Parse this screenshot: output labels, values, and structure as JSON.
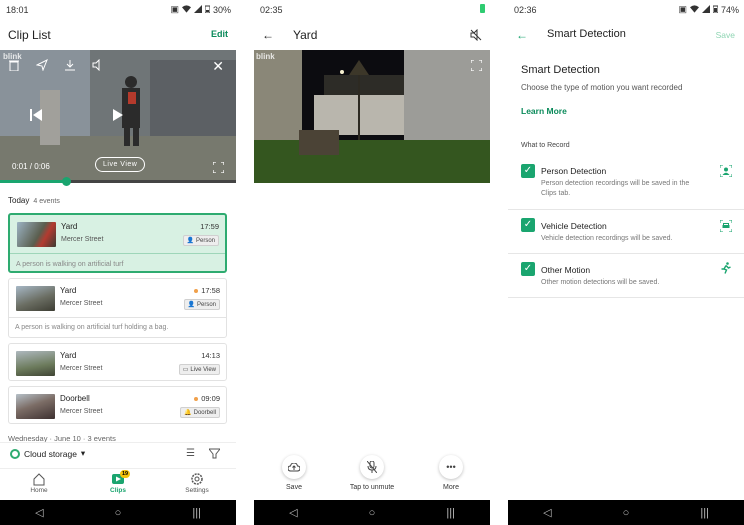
{
  "panel1": {
    "status": {
      "time": "18:01",
      "battery": "30%"
    },
    "header": {
      "title": "Clip List",
      "edit_label": "Edit"
    },
    "video": {
      "time": "0:01 / 0:06",
      "live_view": "Live View",
      "progress_fraction": 0.28,
      "logo": "blink"
    },
    "today": {
      "label": "Today",
      "count": "4 events"
    },
    "clips": [
      {
        "name": "Yard",
        "street": "Mercer Street",
        "time": "17:59",
        "badge": "Person",
        "desc": "A person is walking on artificial turf",
        "active": true,
        "dot": false
      },
      {
        "name": "Yard",
        "street": "Mercer Street",
        "time": "17:58",
        "badge": "Person",
        "desc": "A person is walking on artificial turf holding a bag.",
        "active": false,
        "dot": true
      },
      {
        "name": "Yard",
        "street": "Mercer Street",
        "time": "14:13",
        "badge": "Live View",
        "desc": "",
        "active": false,
        "dot": false
      },
      {
        "name": "Doorbell",
        "street": "Mercer Street",
        "time": "09:09",
        "badge": "Doorbell",
        "desc": "",
        "active": false,
        "dot": true
      }
    ],
    "wednesday": "Wednesday · June 10 · 3 events",
    "cloud_storage": "Cloud storage",
    "tabs": [
      {
        "label": "Home"
      },
      {
        "label": "Clips",
        "badge": "19"
      },
      {
        "label": "Settings"
      }
    ]
  },
  "panel2": {
    "status": {
      "time": "02:35"
    },
    "header": {
      "title": "Yard"
    },
    "video": {
      "logo": "blink"
    },
    "actions": [
      {
        "label": "Save",
        "icon": "cloud-save-icon"
      },
      {
        "label": "Tap to unmute",
        "icon": "mic-off-icon"
      },
      {
        "label": "More",
        "icon": "more-icon"
      }
    ]
  },
  "panel3": {
    "status": {
      "time": "02:36",
      "battery": "74%"
    },
    "header": {
      "title": "Smart Detection",
      "save_label": "Save"
    },
    "section_title": "Smart Detection",
    "section_subtitle": "Choose the type of motion you want recorded",
    "learn_more": "Learn More",
    "what_to_record": "What to Record",
    "options": [
      {
        "title": "Person Detection",
        "desc": "Person detection recordings will be saved in the Clips tab.",
        "icon": "person-frame-icon",
        "checked": true
      },
      {
        "title": "Vehicle Detection",
        "desc": "Vehicle detection recordings will be saved.",
        "icon": "vehicle-frame-icon",
        "checked": true
      },
      {
        "title": "Other Motion",
        "desc": "Other motion detections will be saved.",
        "icon": "running-person-icon",
        "checked": true
      }
    ]
  },
  "colors": {
    "accent": "#1aa56f",
    "active_clip_bg": "#d8f1e3",
    "badge_dot": "#f0a04b"
  }
}
